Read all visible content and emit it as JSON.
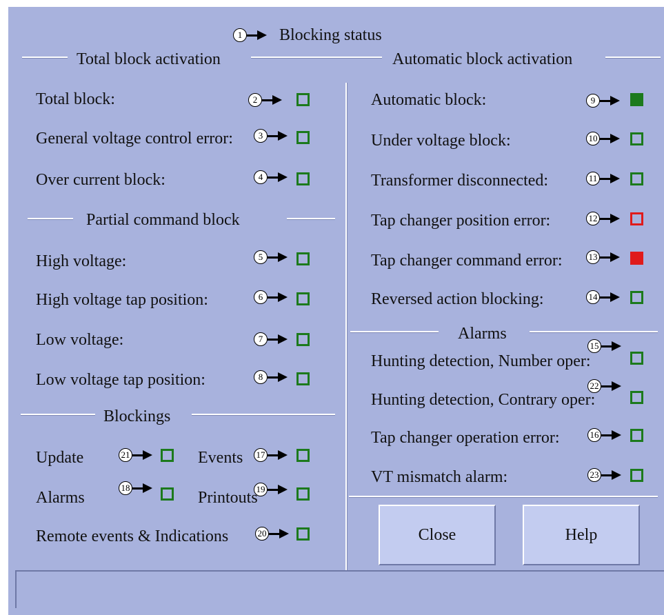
{
  "window": {
    "title": "Blocking status"
  },
  "sections": {
    "total_block_activation": "Total block activation",
    "automatic_block_activation": "Automatic block activation",
    "partial_command_block": "Partial command block",
    "blockings": "Blockings",
    "alarms": "Alarms"
  },
  "callouts": {
    "c1": "1",
    "c2": "2",
    "c3": "3",
    "c4": "4",
    "c5": "5",
    "c6": "6",
    "c7": "7",
    "c8": "8",
    "c9": "9",
    "c10": "10",
    "c11": "11",
    "c12": "12",
    "c13": "13",
    "c14": "14",
    "c15": "15",
    "c16": "16",
    "c17": "17",
    "c18": "18",
    "c19": "19",
    "c20": "20",
    "c21": "21",
    "c22": "22",
    "c23": "23"
  },
  "labels": {
    "total_block": "Total block:",
    "general_voltage_control_error": "General voltage control error:",
    "over_current_block": "Over current block:",
    "high_voltage": "High voltage:",
    "high_voltage_tap_position": "High voltage tap position:",
    "low_voltage": "Low voltage:",
    "low_voltage_tap_position": "Low voltage tap position:",
    "update": "Update",
    "events": "Events",
    "alarms": "Alarms",
    "printouts": "Printouts",
    "remote_events": "Remote events & Indications",
    "automatic_block": "Automatic block:",
    "under_voltage_block": "Under voltage block:",
    "transformer_disconnected": "Transformer disconnected:",
    "tap_changer_position_error": "Tap changer position error:",
    "tap_changer_command_error": "Tap changer command error:",
    "reversed_action_blocking": "Reversed action blocking:",
    "hunting_number_oper": "Hunting detection, Number oper:",
    "hunting_contrary_oper": "Hunting detection, Contrary oper:",
    "tap_changer_operation_error": "Tap changer operation error:",
    "vt_mismatch_alarm": "VT mismatch alarm:"
  },
  "indicators": {
    "total_block": "off",
    "general_voltage_control_error": "off",
    "over_current_block": "off",
    "high_voltage": "off",
    "high_voltage_tap_position": "off",
    "low_voltage": "off",
    "low_voltage_tap_position": "off",
    "update": "off",
    "events": "off",
    "alarms": "off",
    "printouts": "off",
    "remote_events": "off",
    "automatic_block": "on-green",
    "under_voltage_block": "off",
    "transformer_disconnected": "off",
    "tap_changer_position_error": "off-red",
    "tap_changer_command_error": "on-red",
    "reversed_action_blocking": "off",
    "hunting_number_oper": "off",
    "hunting_contrary_oper": "off",
    "tap_changer_operation_error": "off",
    "vt_mismatch_alarm": "off"
  },
  "colors": {
    "background": "#a8b2dd",
    "indicator_green": "#1c7a1c",
    "indicator_red": "#e01b1b",
    "button_face": "#c3ccf0"
  },
  "buttons": {
    "close": "Close",
    "help": "Help"
  },
  "status_bar": {
    "text": ""
  }
}
